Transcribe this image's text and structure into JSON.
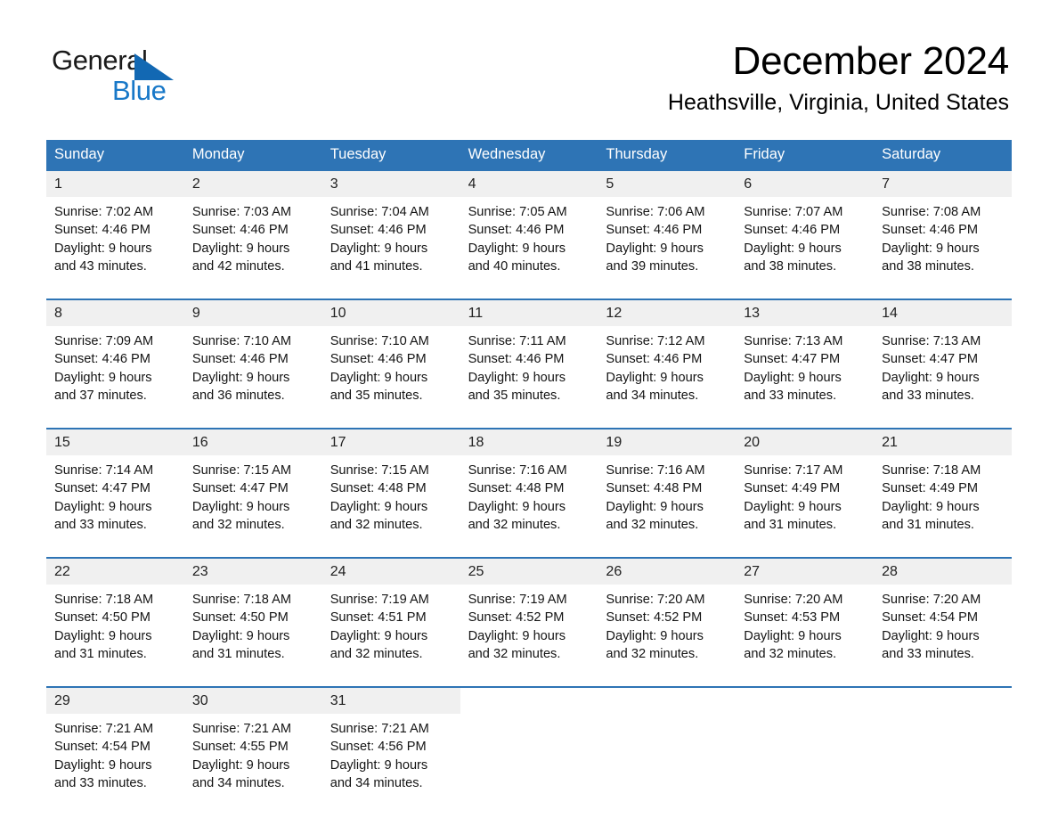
{
  "logo": {
    "word_general": "General",
    "word_blue": "Blue",
    "triangle_color": "#1268b3",
    "blue_text_color": "#1878c8"
  },
  "header": {
    "month_title": "December 2024",
    "location": "Heathsville, Virginia, United States"
  },
  "theme": {
    "header_blue": "#2e74b5",
    "row_divider_blue": "#2e74b5",
    "day_number_band": "#f0f0f0",
    "page_background": "#ffffff",
    "text_color": "#141414"
  },
  "calendar": {
    "weekday_headers": [
      "Sunday",
      "Monday",
      "Tuesday",
      "Wednesday",
      "Thursday",
      "Friday",
      "Saturday"
    ],
    "weeks": [
      [
        {
          "day": "1",
          "sunrise": "Sunrise: 7:02 AM",
          "sunset": "Sunset: 4:46 PM",
          "daylight_line1": "Daylight: 9 hours",
          "daylight_line2": "and 43 minutes."
        },
        {
          "day": "2",
          "sunrise": "Sunrise: 7:03 AM",
          "sunset": "Sunset: 4:46 PM",
          "daylight_line1": "Daylight: 9 hours",
          "daylight_line2": "and 42 minutes."
        },
        {
          "day": "3",
          "sunrise": "Sunrise: 7:04 AM",
          "sunset": "Sunset: 4:46 PM",
          "daylight_line1": "Daylight: 9 hours",
          "daylight_line2": "and 41 minutes."
        },
        {
          "day": "4",
          "sunrise": "Sunrise: 7:05 AM",
          "sunset": "Sunset: 4:46 PM",
          "daylight_line1": "Daylight: 9 hours",
          "daylight_line2": "and 40 minutes."
        },
        {
          "day": "5",
          "sunrise": "Sunrise: 7:06 AM",
          "sunset": "Sunset: 4:46 PM",
          "daylight_line1": "Daylight: 9 hours",
          "daylight_line2": "and 39 minutes."
        },
        {
          "day": "6",
          "sunrise": "Sunrise: 7:07 AM",
          "sunset": "Sunset: 4:46 PM",
          "daylight_line1": "Daylight: 9 hours",
          "daylight_line2": "and 38 minutes."
        },
        {
          "day": "7",
          "sunrise": "Sunrise: 7:08 AM",
          "sunset": "Sunset: 4:46 PM",
          "daylight_line1": "Daylight: 9 hours",
          "daylight_line2": "and 38 minutes."
        }
      ],
      [
        {
          "day": "8",
          "sunrise": "Sunrise: 7:09 AM",
          "sunset": "Sunset: 4:46 PM",
          "daylight_line1": "Daylight: 9 hours",
          "daylight_line2": "and 37 minutes."
        },
        {
          "day": "9",
          "sunrise": "Sunrise: 7:10 AM",
          "sunset": "Sunset: 4:46 PM",
          "daylight_line1": "Daylight: 9 hours",
          "daylight_line2": "and 36 minutes."
        },
        {
          "day": "10",
          "sunrise": "Sunrise: 7:10 AM",
          "sunset": "Sunset: 4:46 PM",
          "daylight_line1": "Daylight: 9 hours",
          "daylight_line2": "and 35 minutes."
        },
        {
          "day": "11",
          "sunrise": "Sunrise: 7:11 AM",
          "sunset": "Sunset: 4:46 PM",
          "daylight_line1": "Daylight: 9 hours",
          "daylight_line2": "and 35 minutes."
        },
        {
          "day": "12",
          "sunrise": "Sunrise: 7:12 AM",
          "sunset": "Sunset: 4:46 PM",
          "daylight_line1": "Daylight: 9 hours",
          "daylight_line2": "and 34 minutes."
        },
        {
          "day": "13",
          "sunrise": "Sunrise: 7:13 AM",
          "sunset": "Sunset: 4:47 PM",
          "daylight_line1": "Daylight: 9 hours",
          "daylight_line2": "and 33 minutes."
        },
        {
          "day": "14",
          "sunrise": "Sunrise: 7:13 AM",
          "sunset": "Sunset: 4:47 PM",
          "daylight_line1": "Daylight: 9 hours",
          "daylight_line2": "and 33 minutes."
        }
      ],
      [
        {
          "day": "15",
          "sunrise": "Sunrise: 7:14 AM",
          "sunset": "Sunset: 4:47 PM",
          "daylight_line1": "Daylight: 9 hours",
          "daylight_line2": "and 33 minutes."
        },
        {
          "day": "16",
          "sunrise": "Sunrise: 7:15 AM",
          "sunset": "Sunset: 4:47 PM",
          "daylight_line1": "Daylight: 9 hours",
          "daylight_line2": "and 32 minutes."
        },
        {
          "day": "17",
          "sunrise": "Sunrise: 7:15 AM",
          "sunset": "Sunset: 4:48 PM",
          "daylight_line1": "Daylight: 9 hours",
          "daylight_line2": "and 32 minutes."
        },
        {
          "day": "18",
          "sunrise": "Sunrise: 7:16 AM",
          "sunset": "Sunset: 4:48 PM",
          "daylight_line1": "Daylight: 9 hours",
          "daylight_line2": "and 32 minutes."
        },
        {
          "day": "19",
          "sunrise": "Sunrise: 7:16 AM",
          "sunset": "Sunset: 4:48 PM",
          "daylight_line1": "Daylight: 9 hours",
          "daylight_line2": "and 32 minutes."
        },
        {
          "day": "20",
          "sunrise": "Sunrise: 7:17 AM",
          "sunset": "Sunset: 4:49 PM",
          "daylight_line1": "Daylight: 9 hours",
          "daylight_line2": "and 31 minutes."
        },
        {
          "day": "21",
          "sunrise": "Sunrise: 7:18 AM",
          "sunset": "Sunset: 4:49 PM",
          "daylight_line1": "Daylight: 9 hours",
          "daylight_line2": "and 31 minutes."
        }
      ],
      [
        {
          "day": "22",
          "sunrise": "Sunrise: 7:18 AM",
          "sunset": "Sunset: 4:50 PM",
          "daylight_line1": "Daylight: 9 hours",
          "daylight_line2": "and 31 minutes."
        },
        {
          "day": "23",
          "sunrise": "Sunrise: 7:18 AM",
          "sunset": "Sunset: 4:50 PM",
          "daylight_line1": "Daylight: 9 hours",
          "daylight_line2": "and 31 minutes."
        },
        {
          "day": "24",
          "sunrise": "Sunrise: 7:19 AM",
          "sunset": "Sunset: 4:51 PM",
          "daylight_line1": "Daylight: 9 hours",
          "daylight_line2": "and 32 minutes."
        },
        {
          "day": "25",
          "sunrise": "Sunrise: 7:19 AM",
          "sunset": "Sunset: 4:52 PM",
          "daylight_line1": "Daylight: 9 hours",
          "daylight_line2": "and 32 minutes."
        },
        {
          "day": "26",
          "sunrise": "Sunrise: 7:20 AM",
          "sunset": "Sunset: 4:52 PM",
          "daylight_line1": "Daylight: 9 hours",
          "daylight_line2": "and 32 minutes."
        },
        {
          "day": "27",
          "sunrise": "Sunrise: 7:20 AM",
          "sunset": "Sunset: 4:53 PM",
          "daylight_line1": "Daylight: 9 hours",
          "daylight_line2": "and 32 minutes."
        },
        {
          "day": "28",
          "sunrise": "Sunrise: 7:20 AM",
          "sunset": "Sunset: 4:54 PM",
          "daylight_line1": "Daylight: 9 hours",
          "daylight_line2": "and 33 minutes."
        }
      ],
      [
        {
          "day": "29",
          "sunrise": "Sunrise: 7:21 AM",
          "sunset": "Sunset: 4:54 PM",
          "daylight_line1": "Daylight: 9 hours",
          "daylight_line2": "and 33 minutes."
        },
        {
          "day": "30",
          "sunrise": "Sunrise: 7:21 AM",
          "sunset": "Sunset: 4:55 PM",
          "daylight_line1": "Daylight: 9 hours",
          "daylight_line2": "and 34 minutes."
        },
        {
          "day": "31",
          "sunrise": "Sunrise: 7:21 AM",
          "sunset": "Sunset: 4:56 PM",
          "daylight_line1": "Daylight: 9 hours",
          "daylight_line2": "and 34 minutes."
        },
        {
          "day": "",
          "sunrise": "",
          "sunset": "",
          "daylight_line1": "",
          "daylight_line2": ""
        },
        {
          "day": "",
          "sunrise": "",
          "sunset": "",
          "daylight_line1": "",
          "daylight_line2": ""
        },
        {
          "day": "",
          "sunrise": "",
          "sunset": "",
          "daylight_line1": "",
          "daylight_line2": ""
        },
        {
          "day": "",
          "sunrise": "",
          "sunset": "",
          "daylight_line1": "",
          "daylight_line2": ""
        }
      ]
    ]
  }
}
